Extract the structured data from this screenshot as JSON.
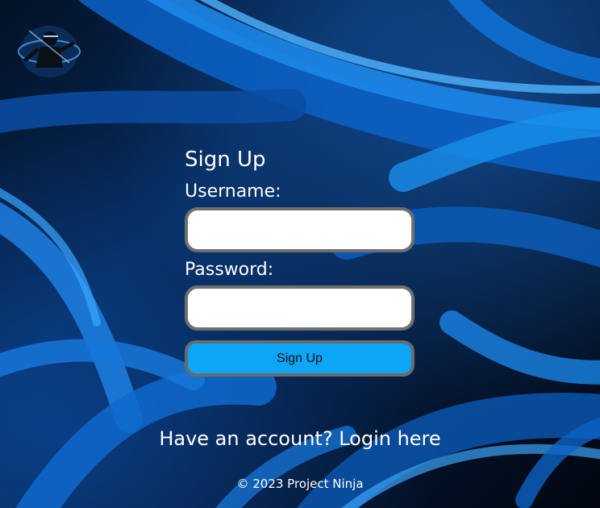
{
  "logo": {
    "icon": "ninja-logo-icon"
  },
  "form": {
    "title": "Sign Up",
    "username_label": "Username:",
    "username_value": "",
    "password_label": "Password:",
    "password_value": "",
    "submit_label": "Sign Up"
  },
  "login_prompt": {
    "text": "Have an account?",
    "link_label": "Login here"
  },
  "footer": {
    "text": "© 2023 Project Ninja"
  },
  "colors": {
    "button_bg": "#0da5f5",
    "input_border": "#6f6f6f",
    "text": "#ffffff"
  }
}
